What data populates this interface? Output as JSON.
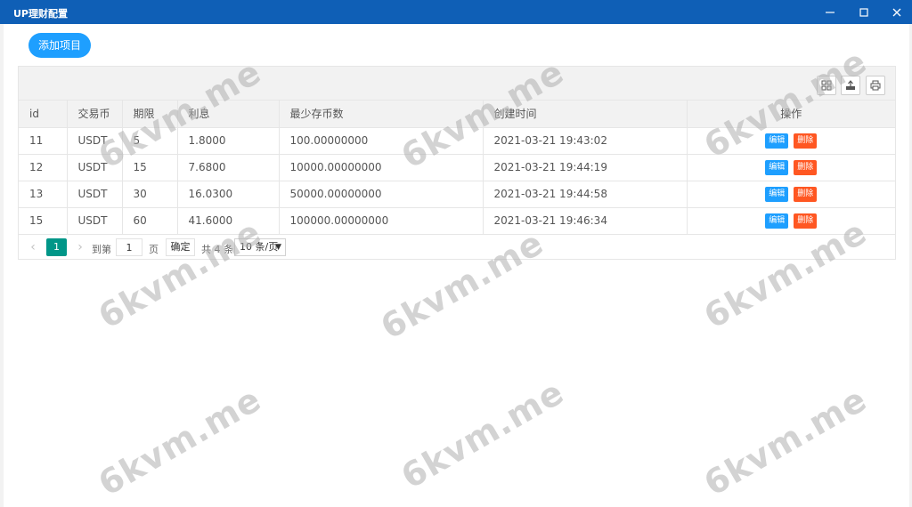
{
  "window": {
    "title": "UP理财配置"
  },
  "actions": {
    "add_label": "添加项目"
  },
  "table": {
    "headers": [
      "id",
      "交易币",
      "期限",
      "利息",
      "最少存币数",
      "创建时间",
      "操作"
    ],
    "rows": [
      {
        "id": "11",
        "coin": "USDT",
        "term": "5",
        "interest": "1.8000",
        "min_deposit": "100.00000000",
        "created": "2021-03-21 19:43:02"
      },
      {
        "id": "12",
        "coin": "USDT",
        "term": "15",
        "interest": "7.6800",
        "min_deposit": "10000.00000000",
        "created": "2021-03-21 19:44:19"
      },
      {
        "id": "13",
        "coin": "USDT",
        "term": "30",
        "interest": "16.0300",
        "min_deposit": "50000.00000000",
        "created": "2021-03-21 19:44:58"
      },
      {
        "id": "15",
        "coin": "USDT",
        "term": "60",
        "interest": "41.6000",
        "min_deposit": "100000.00000000",
        "created": "2021-03-21 19:46:34"
      }
    ],
    "row_actions": {
      "edit": "编辑",
      "delete": "删除"
    }
  },
  "pager": {
    "prev": "‹",
    "next": "›",
    "current": "1",
    "goto_label": "到第",
    "goto_value": "1",
    "page_label": "页",
    "confirm_label": "确定",
    "total_label": "共 4 条",
    "page_size": "10 条/页"
  },
  "watermark": {
    "text": "6kvm.me"
  },
  "colors": {
    "titlebar": "#0f5fb6",
    "primary": "#1e9fff",
    "danger": "#ff5722",
    "pager_active": "#009688"
  }
}
